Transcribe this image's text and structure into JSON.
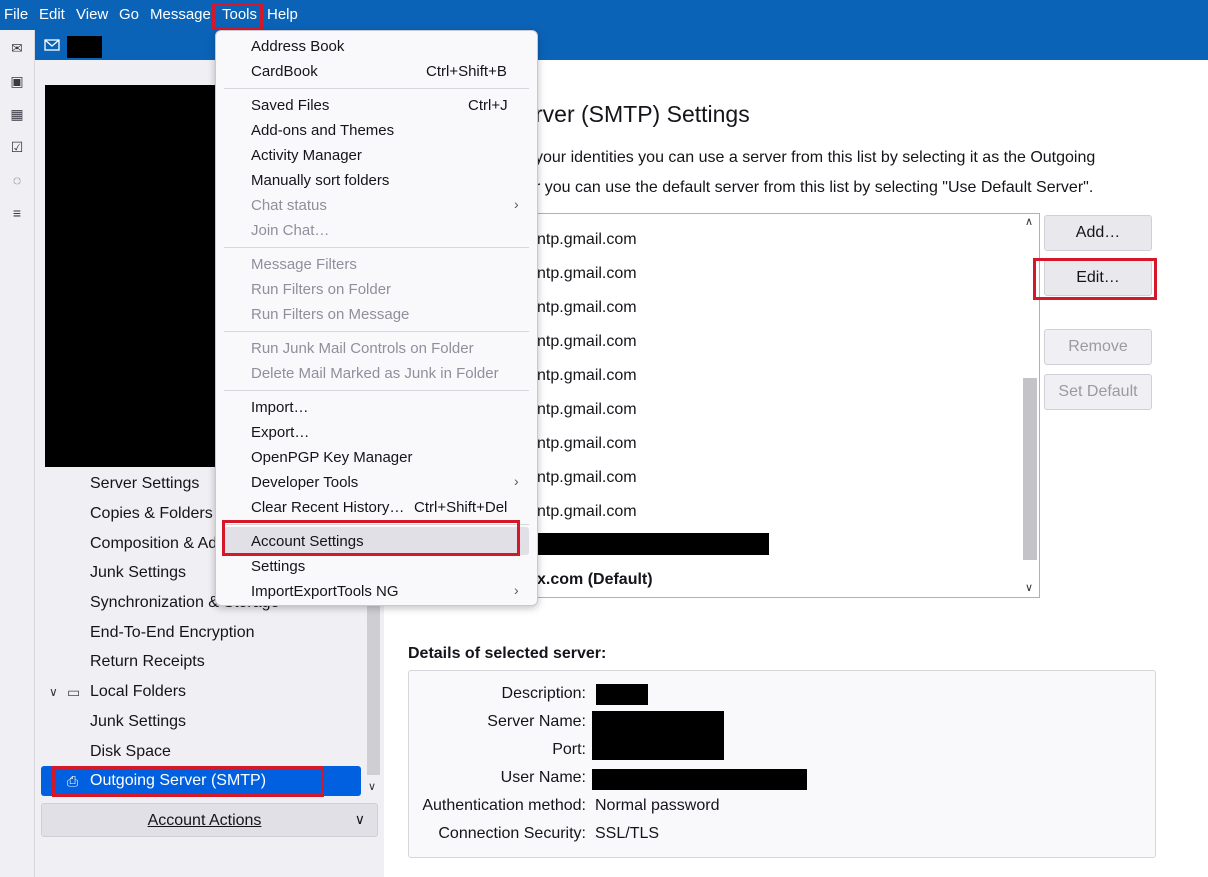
{
  "menubar": {
    "items": [
      "File",
      "Edit",
      "View",
      "Go",
      "Message",
      "Tools",
      "Help"
    ]
  },
  "tools_menu": {
    "items": [
      {
        "label": "Address Book",
        "shortcut": "",
        "disabled": false,
        "submenu": false
      },
      {
        "label": "CardBook",
        "shortcut": "Ctrl+Shift+B",
        "disabled": false,
        "submenu": false
      },
      {
        "label": "Saved Files",
        "shortcut": "Ctrl+J",
        "disabled": false,
        "submenu": false
      },
      {
        "label": "Add-ons and Themes",
        "shortcut": "",
        "disabled": false,
        "submenu": false
      },
      {
        "label": "Activity Manager",
        "shortcut": "",
        "disabled": false,
        "submenu": false
      },
      {
        "label": "Manually sort folders",
        "shortcut": "",
        "disabled": false,
        "submenu": false
      },
      {
        "label": "Chat status",
        "shortcut": "",
        "disabled": true,
        "submenu": true
      },
      {
        "label": "Join Chat…",
        "shortcut": "",
        "disabled": true,
        "submenu": false
      },
      {
        "label": "Message Filters",
        "shortcut": "",
        "disabled": true,
        "submenu": false
      },
      {
        "label": "Run Filters on Folder",
        "shortcut": "",
        "disabled": true,
        "submenu": false
      },
      {
        "label": "Run Filters on Message",
        "shortcut": "",
        "disabled": true,
        "submenu": false
      },
      {
        "label": "Run Junk Mail Controls on Folder",
        "shortcut": "",
        "disabled": true,
        "submenu": false
      },
      {
        "label": "Delete Mail Marked as Junk in Folder",
        "shortcut": "",
        "disabled": true,
        "submenu": false
      },
      {
        "label": "Import…",
        "shortcut": "",
        "disabled": false,
        "submenu": false
      },
      {
        "label": "Export…",
        "shortcut": "",
        "disabled": false,
        "submenu": false
      },
      {
        "label": "OpenPGP Key Manager",
        "shortcut": "",
        "disabled": false,
        "submenu": false
      },
      {
        "label": "Developer Tools",
        "shortcut": "",
        "disabled": false,
        "submenu": true
      },
      {
        "label": "Clear Recent History…",
        "shortcut": "Ctrl+Shift+Del",
        "disabled": false,
        "submenu": false
      },
      {
        "label": "Account Settings",
        "shortcut": "",
        "disabled": false,
        "submenu": false
      },
      {
        "label": "Settings",
        "shortcut": "",
        "disabled": false,
        "submenu": false
      },
      {
        "label": "ImportExportTools NG",
        "shortcut": "",
        "disabled": false,
        "submenu": true
      }
    ]
  },
  "left_tree": {
    "items": [
      "Server Settings",
      "Copies & Folders",
      "Composition & Ad",
      "Junk Settings",
      "Synchronization & Storage",
      "End-To-End Encryption",
      "Return Receipts",
      "Local Folders",
      "Junk Settings",
      "Disk Space"
    ],
    "selected": "Outgoing Server (SMTP)",
    "account_actions": "Account Actions"
  },
  "main": {
    "title": "rver (SMTP) Settings",
    "desc1": "your identities you can use a server from this list by selecting it as the Outgoing",
    "desc2": "r you can use the default server from this list by selecting \"Use Default Server\".",
    "servers": [
      "ntp.gmail.com",
      "ntp.gmail.com",
      "ntp.gmail.com",
      "ntp.gmail.com",
      "ntp.gmail.com",
      "ntp.gmail.com",
      "ntp.gmail.com",
      "ntp.gmail.com",
      "ntp.gmail.com"
    ],
    "default_server": "x.com (Default)",
    "buttons": {
      "add": "Add…",
      "edit": "Edit…",
      "remove": "Remove",
      "set_default": "Set Default"
    },
    "details_title": "Details of selected server:",
    "details": {
      "description_label": "Description:",
      "server_name_label": "Server Name:",
      "port_label": "Port:",
      "user_name_label": "User Name:",
      "auth_label": "Authentication method:",
      "auth_value": "Normal password",
      "security_label": "Connection Security:",
      "security_value": "SSL/TLS"
    }
  },
  "colors": {
    "accent": "#0b63b8",
    "selection": "#0060df",
    "highlight_box": "#d4182a"
  }
}
